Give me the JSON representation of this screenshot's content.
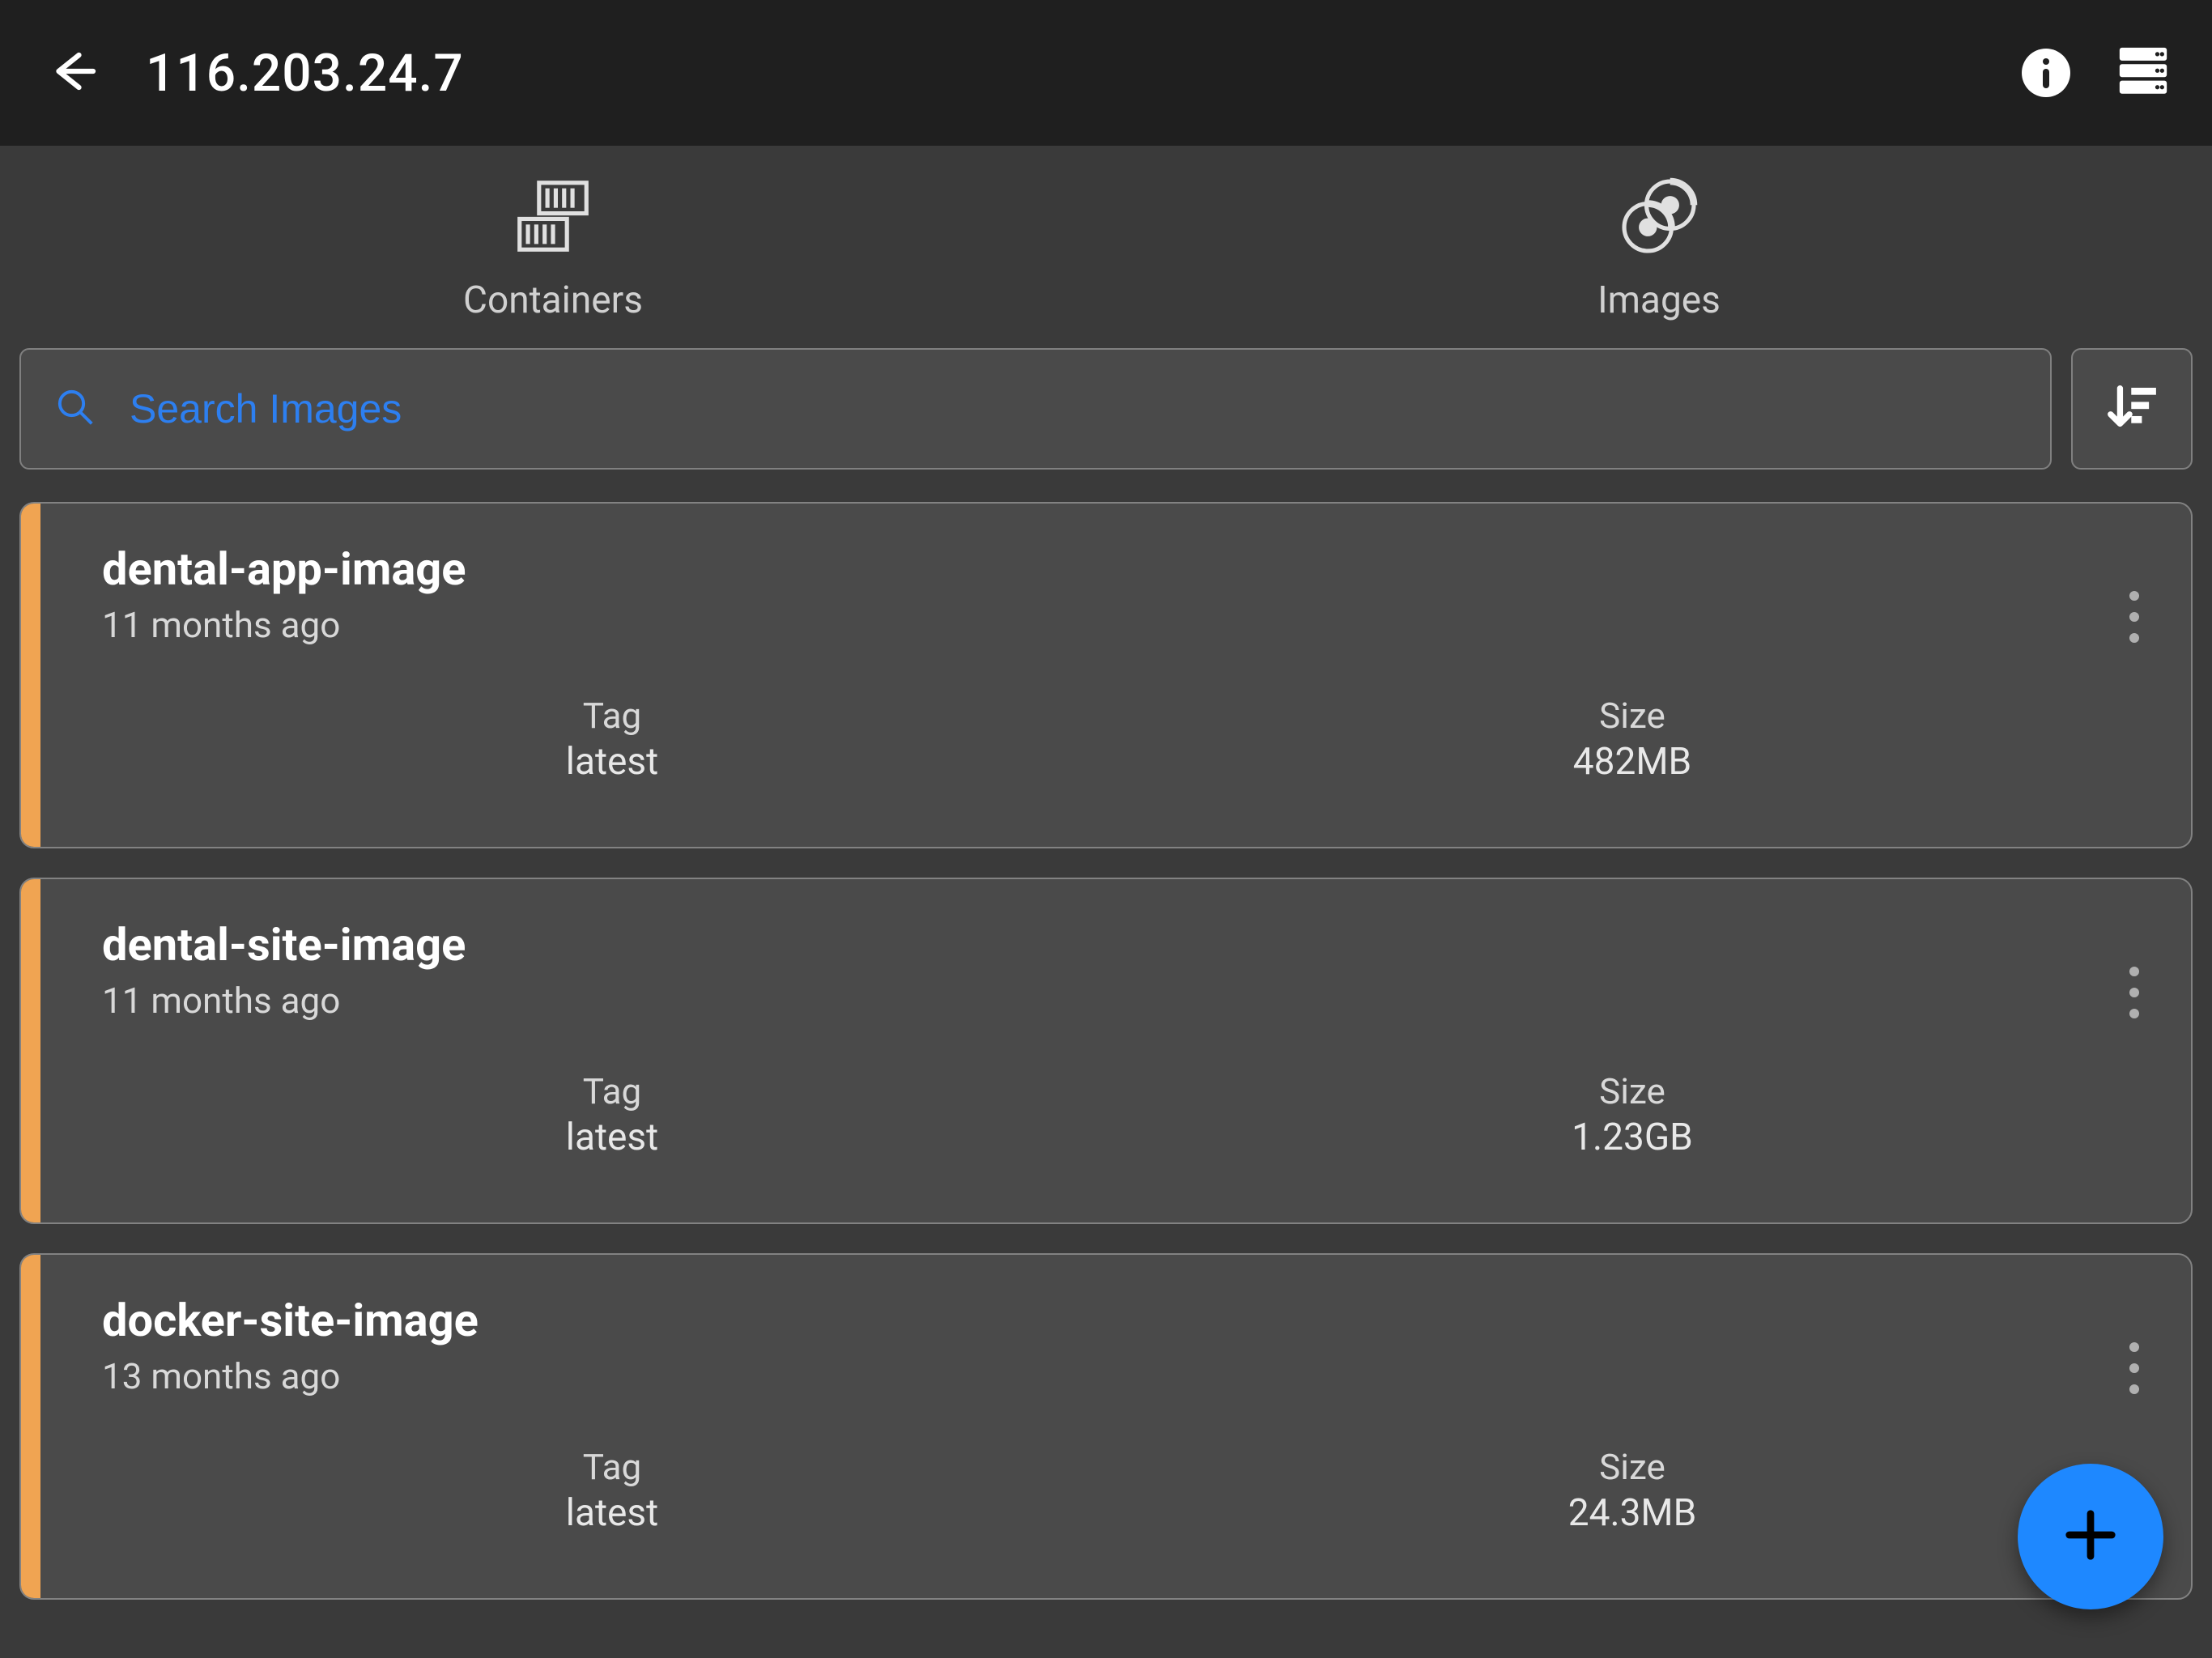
{
  "header": {
    "title": "116.203.24.7"
  },
  "tabs": {
    "containers_label": "Containers",
    "images_label": "Images"
  },
  "search": {
    "placeholder": "Search Images"
  },
  "meta_labels": {
    "tag": "Tag",
    "size": "Size"
  },
  "images": [
    {
      "name": "dental-app-image",
      "age": "11 months ago",
      "tag": "latest",
      "size": "482MB",
      "accent": "#f0a452"
    },
    {
      "name": "dental-site-image",
      "age": "11 months ago",
      "tag": "latest",
      "size": "1.23GB",
      "accent": "#f0a452"
    },
    {
      "name": "docker-site-image",
      "age": "13 months ago",
      "tag": "latest",
      "size": "24.3MB",
      "accent": "#f0a452"
    }
  ]
}
